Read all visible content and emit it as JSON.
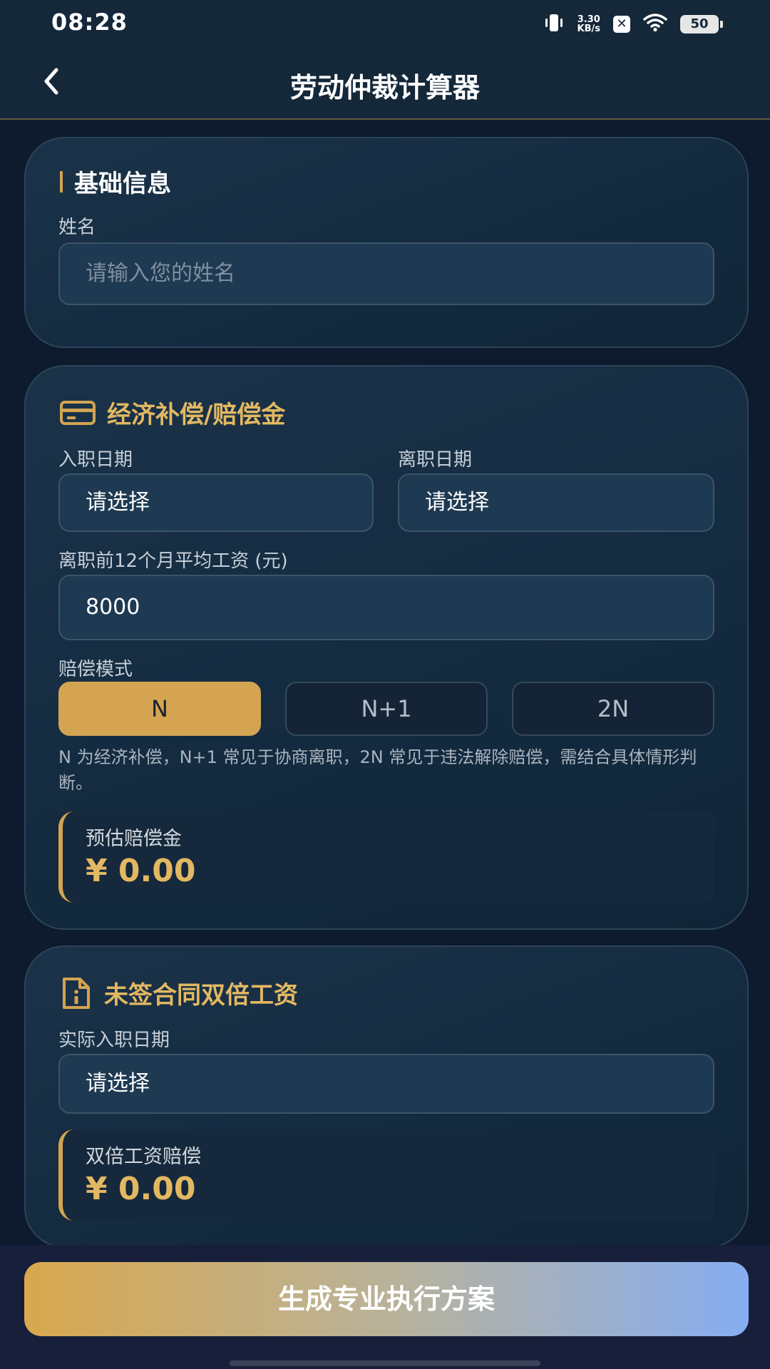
{
  "status_bar": {
    "time": "08:28",
    "net_speed_value": "3.30",
    "net_speed_unit": "KB/s",
    "battery": "50",
    "icons": [
      "vibrate-icon",
      "x-app-icon",
      "wifi-icon",
      "battery-icon"
    ]
  },
  "header": {
    "title": "劳动仲裁计算器",
    "back_icon": "chevron-left-icon"
  },
  "basic_info": {
    "title": "基础信息",
    "name_label": "姓名",
    "name_placeholder": "请输入您的姓名"
  },
  "compensation": {
    "title": "经济补偿/赔偿金",
    "icon": "card-icon",
    "start_date_label": "入职日期",
    "start_date_value": "请选择",
    "end_date_label": "离职日期",
    "end_date_value": "请选择",
    "salary_label": "离职前12个月平均工资 (元)",
    "salary_value": "8000",
    "mode_label": "赔偿模式",
    "modes": [
      "N",
      "N+1",
      "2N"
    ],
    "selected_mode": "N",
    "hint": "N 为经济补偿，N+1 常见于协商离职，2N 常见于违法解除赔偿，需结合具体情形判断。",
    "result_label": "预估赔偿金",
    "result_value": "¥ 0.00"
  },
  "double_wage": {
    "title": "未签合同双倍工资",
    "icon": "document-info-icon",
    "date_label": "实际入职日期",
    "date_value": "请选择",
    "result_label": "双倍工资赔偿",
    "result_value": "¥ 0.00"
  },
  "actions": {
    "generate_label": "生成专业执行方案"
  },
  "colors": {
    "accent_gold": "#d4a452",
    "card_bg": "#1b3349",
    "page_bg": "#0e1a2d",
    "button_gradient_end": "#86aef2"
  }
}
